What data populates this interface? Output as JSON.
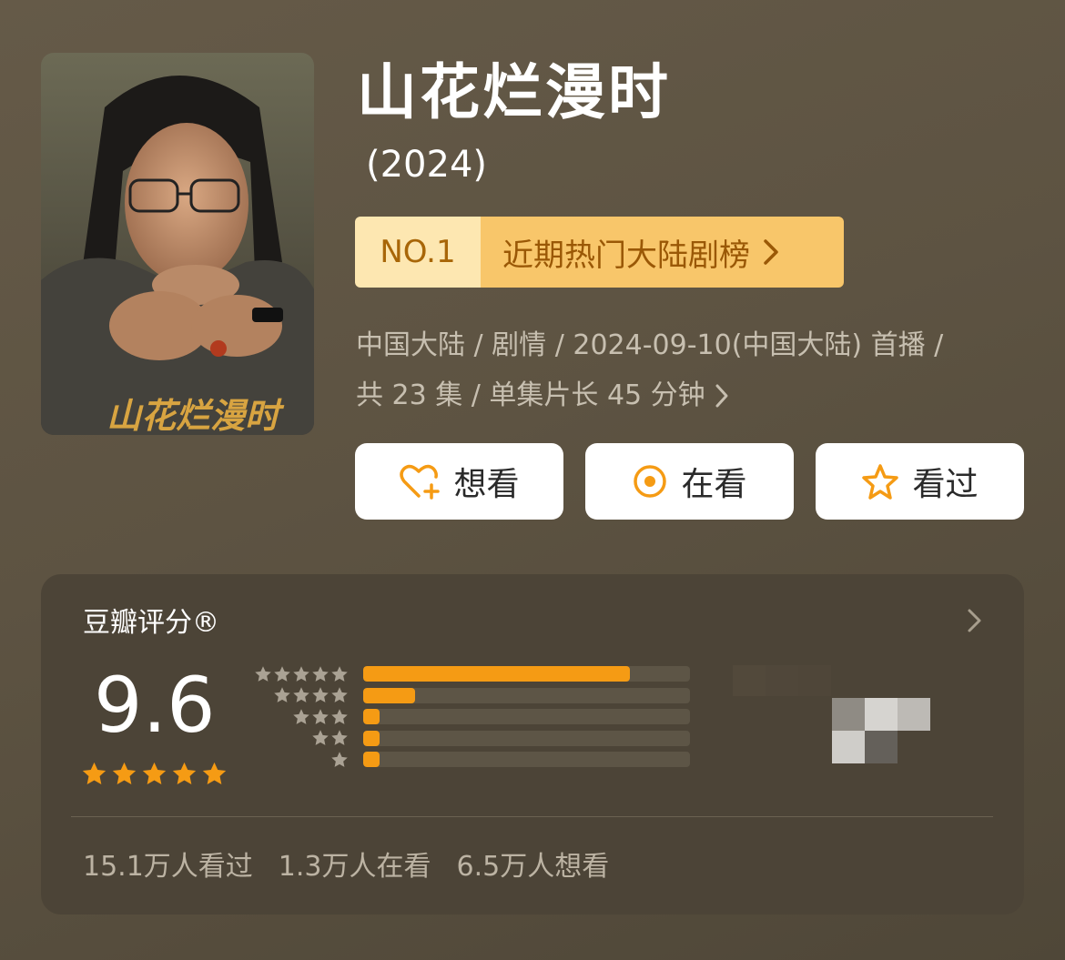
{
  "show": {
    "title": "山花烂漫时",
    "year": "(2024)",
    "poster_calligraphy": "山花烂漫时"
  },
  "rank": {
    "no": "NO.1",
    "list": "近期热门大陆剧榜"
  },
  "meta": {
    "line1": "中国大陆 / 剧情 / 2024-09-10(中国大陆) 首播 /",
    "line2": "共 23 集 / 单集片长 45 分钟"
  },
  "actions": {
    "want": "想看",
    "watching": "在看",
    "watched": "看过"
  },
  "rating": {
    "title": "豆瓣评分®",
    "score": "9.6",
    "stars": 5,
    "distribution": [
      {
        "stars": 5,
        "fraction": 0.815
      },
      {
        "stars": 4,
        "fraction": 0.16
      },
      {
        "stars": 3,
        "fraction": 0.05
      },
      {
        "stars": 2,
        "fraction": 0.05
      },
      {
        "stars": 1,
        "fraction": 0.05
      }
    ]
  },
  "counts": {
    "watched": "15.1万人看过",
    "watching": "1.3万人在看",
    "want": "6.5万人想看"
  },
  "colors": {
    "accent": "#f59b14",
    "rank_bg_light": "#fde7b1",
    "rank_bg": "#f8c66a"
  }
}
